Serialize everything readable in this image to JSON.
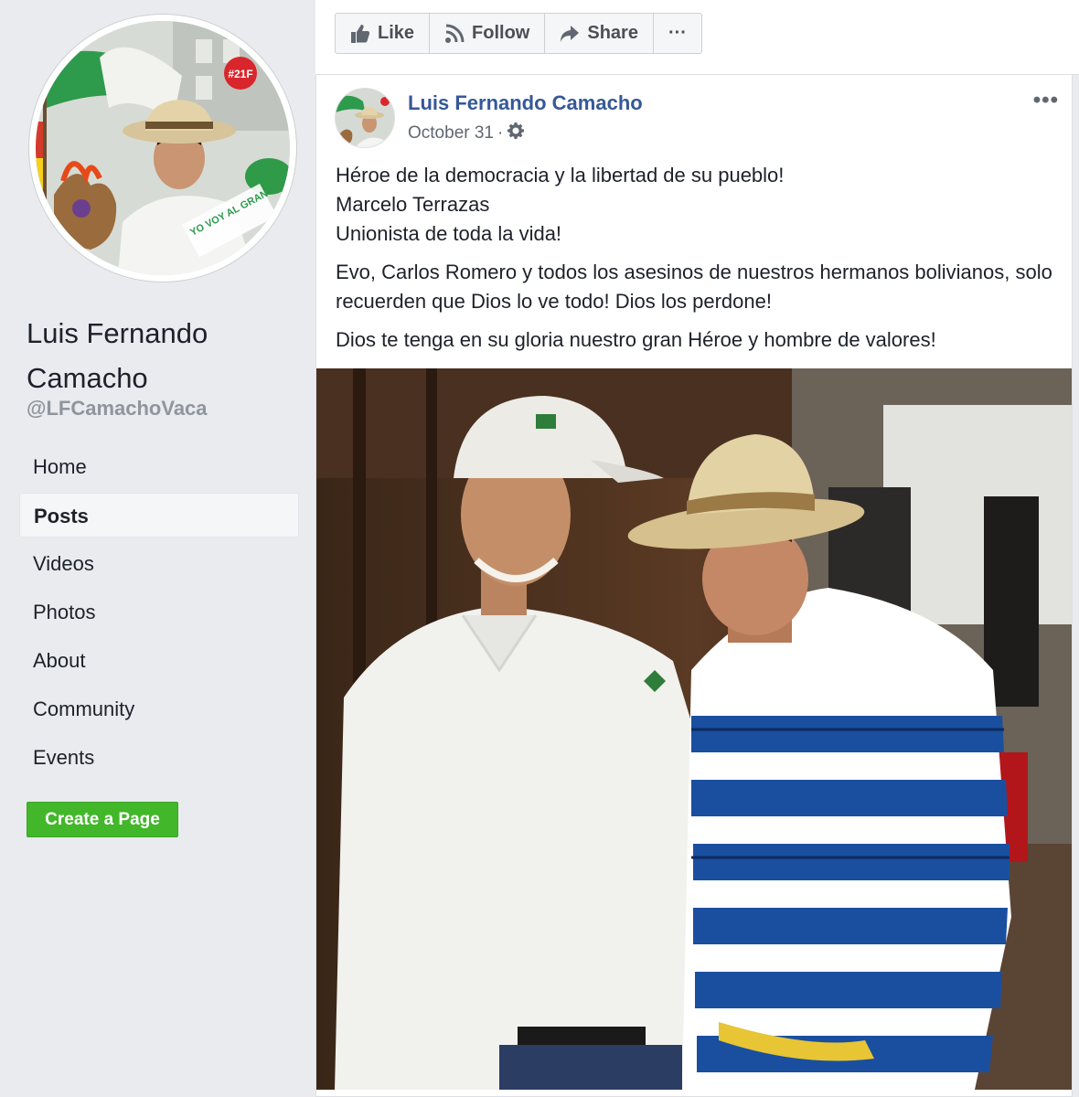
{
  "sidebar": {
    "page_name": "Luis Fernando Camacho",
    "handle": "@LFCamachoVaca",
    "nav": [
      {
        "label": "Home",
        "active": false
      },
      {
        "label": "Posts",
        "active": true
      },
      {
        "label": "Videos",
        "active": false
      },
      {
        "label": "Photos",
        "active": false
      },
      {
        "label": "About",
        "active": false
      },
      {
        "label": "Community",
        "active": false
      },
      {
        "label": "Events",
        "active": false
      }
    ],
    "create_page_label": "Create a Page",
    "profile_badge": "#21F",
    "profile_banner": "YO VOY AL GRAN CABILDO"
  },
  "actions": {
    "like_label": "Like",
    "follow_label": "Follow",
    "share_label": "Share",
    "more_label": "···"
  },
  "post": {
    "author": "Luis Fernando Camacho",
    "date": "October 31",
    "separator": "·",
    "menu_label": "•••",
    "paragraphs": [
      [
        "Héroe de la democracia y la libertad de su pueblo!",
        "Marcelo Terrazas",
        "Unionista de toda la vida!"
      ],
      [
        "Evo, Carlos Romero y todos los asesinos de nuestros hermanos bolivianos, solo recuerden que Dios lo ve todo! Dios los perdone!"
      ],
      [
        "Dios te tenga en su gloria nuestro gran Héroe y hombre de valores!"
      ]
    ]
  },
  "colors": {
    "link_blue": "#365899",
    "green_button": "#42b72a",
    "page_bg": "#e9ebee"
  }
}
